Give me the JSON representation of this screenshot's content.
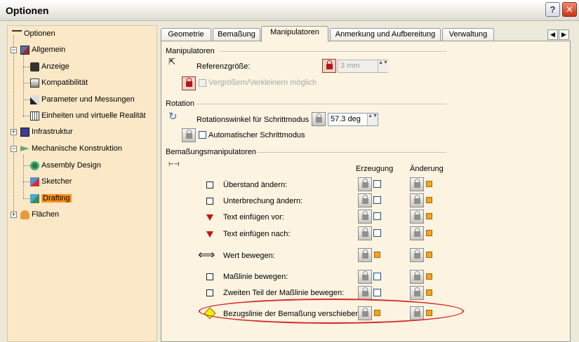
{
  "window": {
    "title": "Optionen",
    "help_glyph": "?",
    "close_glyph": "✕"
  },
  "tree": {
    "root": "Optionen",
    "items": [
      {
        "label": "Allgemein"
      },
      {
        "label": "Anzeige"
      },
      {
        "label": "Kompatibilität"
      },
      {
        "label": "Parameter und Messungen"
      },
      {
        "label": "Einheiten und virtuelle Realität"
      },
      {
        "label": "Infrastruktur"
      },
      {
        "label": "Mechanische Konstruktion"
      },
      {
        "label": "Assembly Design"
      },
      {
        "label": "Sketcher"
      },
      {
        "label": "Drafting"
      },
      {
        "label": "Flächen"
      }
    ],
    "selected": "Drafting"
  },
  "tabs": [
    {
      "label": "Geometrie"
    },
    {
      "label": "Bemaßung"
    },
    {
      "label": "Manipulatoren"
    },
    {
      "label": "Anmerkung und Aufbereitung"
    },
    {
      "label": "Verwaltung"
    }
  ],
  "tab_scroll": {
    "left": "◀",
    "right": "▶"
  },
  "active_tab": "Manipulatoren",
  "manipulators": {
    "title": "Manipulatoren",
    "ref_label": "Referenzgröße:",
    "ref_value": "3 mm",
    "scale_label": "Vergrößern/Verkleinern möglich"
  },
  "rotation": {
    "title": "Rotation",
    "step_label": "Rotationswinkel für Schrittmodus",
    "step_value": "57.3 deg",
    "auto_label": "Automatischer Schrittmodus"
  },
  "dim_manipulators": {
    "title": "Bemaßungsmanipulatoren",
    "col_create": "Erzeugung",
    "col_modify": "Änderung",
    "rows": [
      {
        "label": "Überstand ändern:"
      },
      {
        "label": "Unterbrechung ändern:"
      },
      {
        "label": "Text einfügen vor:"
      },
      {
        "label": "Text einfügen nach:"
      },
      {
        "label": "Wert bewegen:"
      },
      {
        "label": "Maßlinie bewegen:"
      },
      {
        "label": "Zweiten Teil der Maßlinie bewegen:"
      },
      {
        "label": "Bezugslinie der Bemaßung verschieben"
      }
    ]
  },
  "icons": {
    "spin_arrows": "▲▼",
    "value_arrow": "⟺",
    "manip_cursor": "⇱",
    "rotation_icon": "↻",
    "dim_icon": "⊢⊣"
  },
  "colors": {
    "highlight_ellipse": "#d42a2a",
    "tree_bg": "#fbe8c7",
    "selected": "#f7921e"
  }
}
